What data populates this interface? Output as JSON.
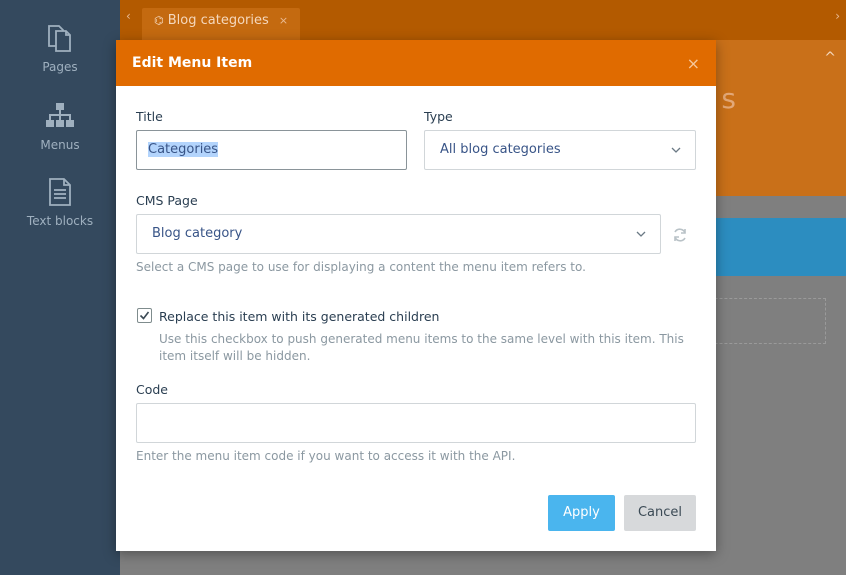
{
  "sidebar": {
    "items": [
      {
        "label": "Pages",
        "icon": "pages-icon"
      },
      {
        "label": "Menus",
        "icon": "sitemap-icon"
      },
      {
        "label": "Text blocks",
        "icon": "document-icon"
      }
    ]
  },
  "tabs": [
    {
      "label": "Blog categories",
      "icon": "sitemap-icon"
    }
  ],
  "background": {
    "partial_title": "s"
  },
  "modal": {
    "title": "Edit Menu Item",
    "close": "×",
    "title_field": {
      "label": "Title",
      "value": "Categories"
    },
    "type_field": {
      "label": "Type",
      "value": "All blog categories"
    },
    "cms_page_field": {
      "label": "CMS Page",
      "value": "Blog category",
      "help": "Select a CMS page to use for displaying a content the menu item refers to."
    },
    "replace_checkbox": {
      "label": "Replace this item with its generated children",
      "checked": true,
      "help": "Use this checkbox to push generated menu items to the same level with this item. This item itself will be hidden."
    },
    "code_field": {
      "label": "Code",
      "value": "",
      "help": "Enter the menu item code if you want to access it with the API."
    },
    "apply_label": "Apply",
    "cancel_label": "Cancel"
  },
  "colors": {
    "header": "#e06b00",
    "apply": "#4ab5ee",
    "sidebar": "#34495e"
  }
}
